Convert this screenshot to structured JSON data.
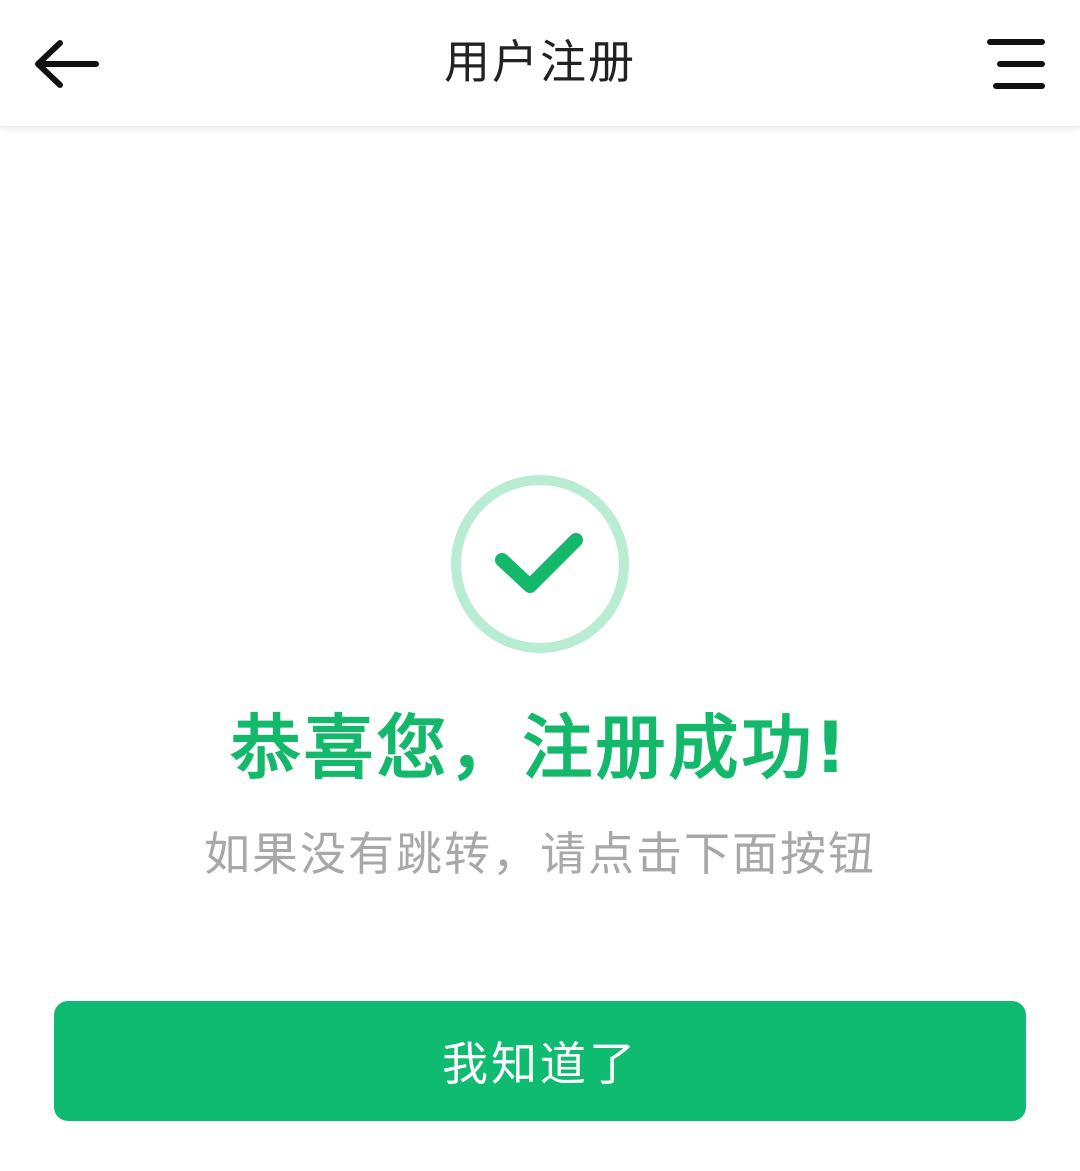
{
  "header": {
    "title": "用户注册",
    "back_icon": "arrow-left-icon",
    "menu_icon": "menu-icon"
  },
  "main": {
    "status_icon": "check-circle-icon",
    "headline": "恭喜您，注册成功!",
    "subtext": "如果没有跳转，请点击下面按钮",
    "confirm_label": "我知道了"
  },
  "colors": {
    "accent": "#0fba71",
    "headline": "#14b86b",
    "icon_ring": "#b8ecd3",
    "subtext": "#a8a8a8",
    "title": "#222222"
  }
}
